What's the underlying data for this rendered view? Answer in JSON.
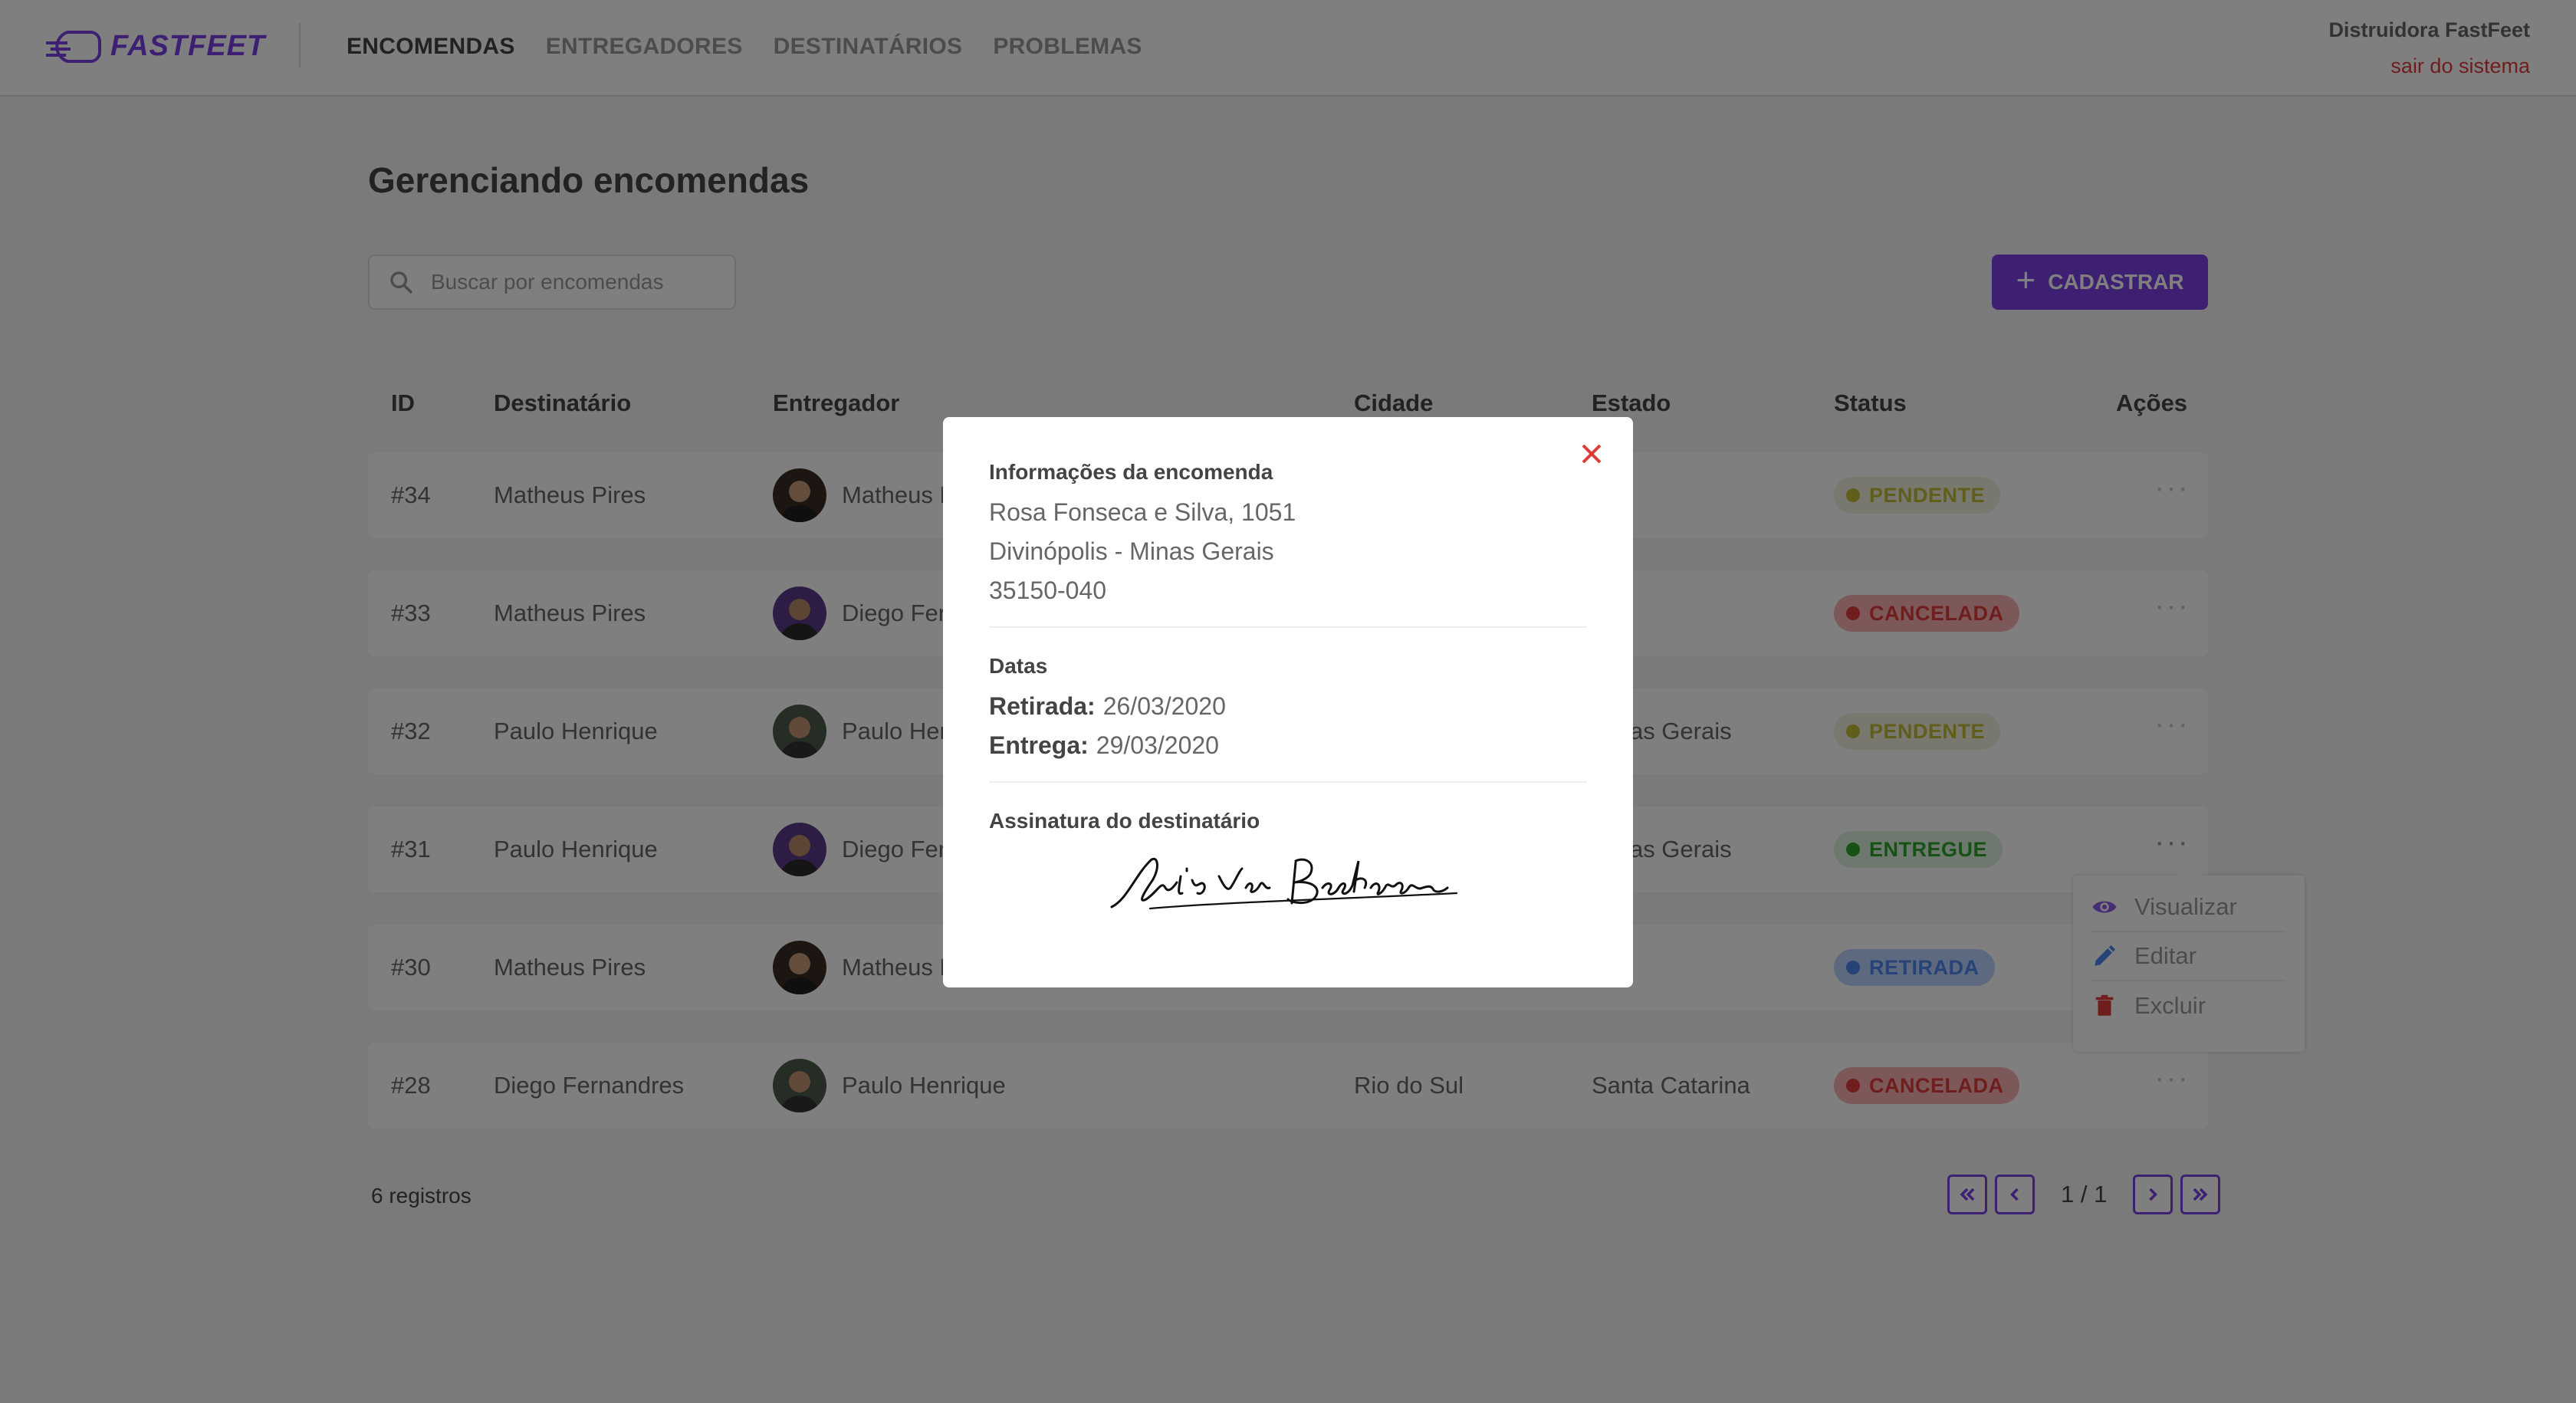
{
  "header": {
    "logo_text": "FASTFEET",
    "nav": [
      "ENCOMENDAS",
      "ENTREGADORES",
      "DESTINATÁRIOS",
      "PROBLEMAS"
    ],
    "active_nav": "ENCOMENDAS",
    "user_name": "Distruidora FastFeet",
    "logout_label": "sair do sistema"
  },
  "main": {
    "title": "Gerenciando encomendas",
    "search_placeholder": "Buscar por encomendas",
    "add_button_label": "CADASTRAR",
    "columns": [
      "ID",
      "Destinatário",
      "Entregador",
      "Cidade",
      "Estado",
      "Status",
      "Ações"
    ],
    "rows": [
      {
        "id": "#34",
        "recipient": "Matheus Pires",
        "deliveryman": "Matheus Pires",
        "city": "",
        "state": "",
        "status": "PENDENTE"
      },
      {
        "id": "#33",
        "recipient": "Matheus Pires",
        "deliveryman": "Diego Fernandres",
        "city": "",
        "state": "",
        "status": "CANCELADA"
      },
      {
        "id": "#32",
        "recipient": "Paulo Henrique",
        "deliveryman": "Paulo Henrique",
        "city": "",
        "state": "Minas Gerais",
        "status": "PENDENTE"
      },
      {
        "id": "#31",
        "recipient": "Paulo Henrique",
        "deliveryman": "Diego Fernandres",
        "city": "",
        "state": "Minas Gerais",
        "status": "ENTREGUE"
      },
      {
        "id": "#30",
        "recipient": "Matheus Pires",
        "deliveryman": "Matheus Pires",
        "city": "",
        "state": "",
        "status": "RETIRADA"
      },
      {
        "id": "#28",
        "recipient": "Diego Fernandres",
        "deliveryman": "Paulo Henrique",
        "city": "Rio do Sul",
        "state": "Santa Catarina",
        "status": "CANCELADA"
      }
    ],
    "record_count": "6 registros",
    "pagination": "1 / 1"
  },
  "action_menu": {
    "items": [
      "Visualizar",
      "Editar",
      "Excluir"
    ]
  },
  "modal": {
    "info_heading": "Informações da encomenda",
    "address_line1": "Rosa Fonseca e Silva, 1051",
    "address_line2": "Divinópolis - Minas Gerais",
    "zip": "35150-040",
    "dates_heading": "Datas",
    "pickup_label": "Retirada:",
    "pickup_date": "26/03/2020",
    "delivery_label": "Entrega:",
    "delivery_date": "29/03/2020",
    "signature_heading": "Assinatura do destinatário"
  },
  "status_colors": {
    "PENDENTE": {
      "bg": "#f0f0df",
      "fg": "#c1bc35"
    },
    "CANCELADA": {
      "bg": "#fab0b0",
      "fg": "#de3b3b"
    },
    "ENTREGUE": {
      "bg": "#dff0df",
      "fg": "#2ca42b"
    },
    "RETIRADA": {
      "bg": "#bad2ff",
      "fg": "#4d85ee"
    }
  },
  "colors": {
    "brand": "#7d40e7",
    "danger": "#de3b3b"
  }
}
